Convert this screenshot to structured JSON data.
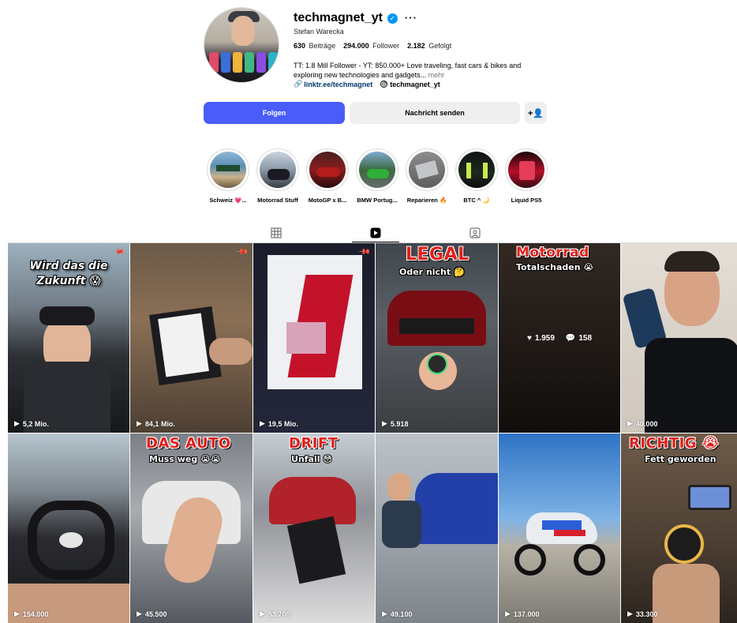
{
  "profile": {
    "username": "techmagnet_yt",
    "verified_icon": "verified-badge-icon",
    "more_icon": "···",
    "full_name": "Stefan Warecka",
    "stats": {
      "posts_count": "630",
      "posts_label": "Beiträge",
      "followers_count": "294.000",
      "followers_label": "Follower",
      "following_count": "2.182",
      "following_label": "Gefolgt"
    },
    "bio_line1": "TT: 1.8 Mill Follower - YT: 850.000+ Love traveling, fast cars & bikes and",
    "bio_line2": "exploring new technologies and gadgets...",
    "bio_more": "mehr",
    "link_text": "linktr.ee/techmagnet",
    "threads_text": "techmagnet_yt"
  },
  "actions": {
    "follow": "Folgen",
    "message": "Nachricht senden",
    "add_user_icon": "+👤"
  },
  "highlights": [
    {
      "label": "Schweiz 💗..."
    },
    {
      "label": "Motorrad Stuff"
    },
    {
      "label": "MotoGP x B..."
    },
    {
      "label": "BMW Portug..."
    },
    {
      "label": "Reparieren 🔥"
    },
    {
      "label": "BTC ^ 🌙"
    },
    {
      "label": "Liquid PS5"
    }
  ],
  "tabs": {
    "posts_icon": "grid-icon",
    "reels_icon": "reels-icon",
    "tagged_icon": "tagged-icon",
    "active": "reels"
  },
  "reels": [
    {
      "views": "5,2 Mio.",
      "pinned": true,
      "caption_white": "Wird das die Zukunft 😱"
    },
    {
      "views": "84,1 Mio.",
      "pinned": true
    },
    {
      "views": "19,5 Mio.",
      "pinned": true
    },
    {
      "views": "5.918",
      "caption_red": "LEGAL",
      "caption_sub": "Oder nicht 🤔"
    },
    {
      "caption_red": "Motorrad",
      "caption_sub": "Totalschaden 😭",
      "likes": "1.959",
      "comments": "158"
    },
    {
      "views": "40.000"
    },
    {
      "views": "154.000"
    },
    {
      "views": "45.500",
      "caption_red": "DAS AUTO",
      "caption_sub": "Muss weg 😭😭"
    },
    {
      "views": "53.700",
      "caption_red": "DRIFT",
      "caption_sub": "Unfall 😳"
    },
    {
      "views": "49.100"
    },
    {
      "views": "137.000"
    },
    {
      "views": "33.300",
      "caption_red": "RICHTIG 😭",
      "caption_sub": "Fett geworden"
    }
  ],
  "colors": {
    "follow_button": "#4a5df9",
    "secondary_button": "#efefef",
    "link": "#00376b",
    "verified": "#0095f6",
    "caption_red": "#e0201c"
  }
}
